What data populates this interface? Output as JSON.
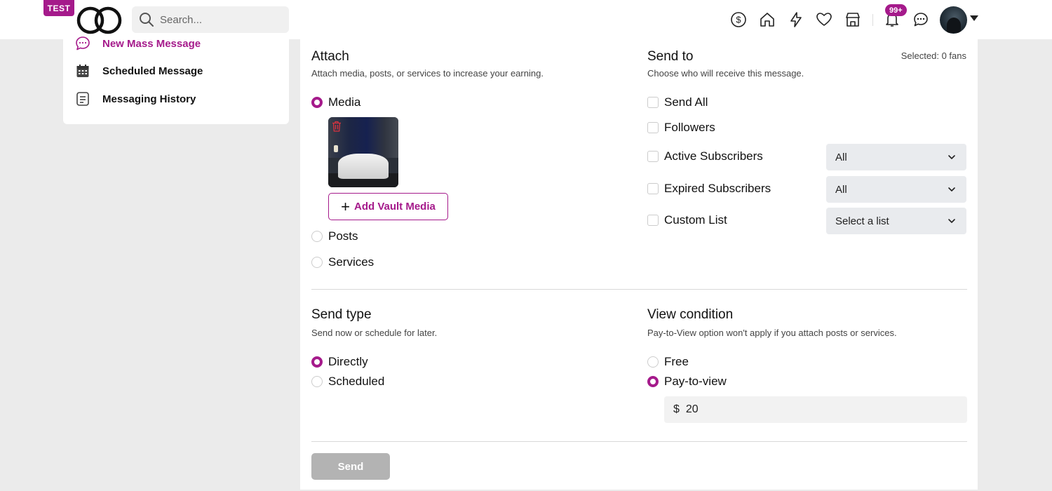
{
  "header": {
    "badge": "TEST",
    "search_placeholder": "Search...",
    "notifications_count": "99+"
  },
  "sidebar": {
    "items": [
      {
        "label": "New Mass Message",
        "icon": "chat-dots-icon",
        "active": true
      },
      {
        "label": "Scheduled Message",
        "icon": "calendar-icon",
        "active": false
      },
      {
        "label": "Messaging History",
        "icon": "document-list-icon",
        "active": false
      }
    ]
  },
  "attach": {
    "title": "Attach",
    "subtitle": "Attach media, posts, or services to increase your earning.",
    "options": [
      {
        "label": "Media",
        "checked": true
      },
      {
        "label": "Posts",
        "checked": false
      },
      {
        "label": "Services",
        "checked": false
      }
    ],
    "add_vault_label": "Add Vault Media"
  },
  "send_to": {
    "title": "Send to",
    "subtitle": "Choose who will receive this message.",
    "selected_text": "Selected: 0 fans",
    "options": [
      {
        "label": "Send All",
        "checked": false
      },
      {
        "label": "Followers",
        "checked": false
      },
      {
        "label": "Active Subscribers",
        "checked": false,
        "select_value": "All"
      },
      {
        "label": "Expired Subscribers",
        "checked": false,
        "select_value": "All"
      },
      {
        "label": "Custom List",
        "checked": false,
        "select_value": "Select a list"
      }
    ]
  },
  "send_type": {
    "title": "Send type",
    "subtitle": "Send now or schedule for later.",
    "options": [
      {
        "label": "Directly",
        "checked": true
      },
      {
        "label": "Scheduled",
        "checked": false
      }
    ]
  },
  "view_condition": {
    "title": "View condition",
    "subtitle": "Pay-to-View option won't apply if you attach posts or services.",
    "options": [
      {
        "label": "Free",
        "checked": false
      },
      {
        "label": "Pay-to-view",
        "checked": true
      }
    ],
    "currency": "$",
    "price": "20"
  },
  "footer": {
    "send_label": "Send"
  },
  "colors": {
    "accent": "#a51a8b",
    "disabled_button": "#b3b3b3",
    "page_background": "#ebebeb"
  }
}
